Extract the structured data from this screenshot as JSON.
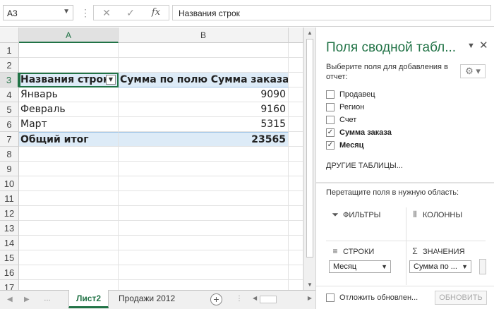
{
  "formula_bar": {
    "name_box": "A3",
    "cancel_icon": "✕",
    "enter_icon": "✓",
    "fx_label": "fx",
    "content": "Названия строк"
  },
  "sheet": {
    "columns": [
      "A",
      "B"
    ],
    "rows": [
      "1",
      "2",
      "3",
      "4",
      "5",
      "6",
      "7",
      "8",
      "9",
      "10",
      "11",
      "12",
      "13",
      "14",
      "15",
      "16",
      "17"
    ],
    "pivot": {
      "header_rows": "Названия строк",
      "header_values": "Сумма по полю Сумма заказа",
      "items": [
        {
          "label": "Январь",
          "value": "9090"
        },
        {
          "label": "Февраль",
          "value": "9160"
        },
        {
          "label": "Март",
          "value": "5315"
        }
      ],
      "total_label": "Общий итог",
      "total_value": "23565"
    }
  },
  "tabs": {
    "items": [
      "Лист2",
      "Продажи 2012"
    ],
    "active": "Лист2"
  },
  "pane": {
    "title": "Поля сводной табл...",
    "subtitle": "Выберите поля для добавления в отчет:",
    "fields": [
      {
        "label": "Продавец",
        "checked": false
      },
      {
        "label": "Регион",
        "checked": false
      },
      {
        "label": "Счет",
        "checked": false
      },
      {
        "label": "Сумма заказа",
        "checked": true
      },
      {
        "label": "Месяц",
        "checked": true
      }
    ],
    "other_tables": "ДРУГИЕ ТАБЛИЦЫ...",
    "drag_hint": "Перетащите поля в нужную область:",
    "areas": {
      "filters": "ФИЛЬТРЫ",
      "columns": "КОЛОННЫ",
      "rows": "СТРОКИ",
      "values": "ЗНАЧЕНИЯ"
    },
    "rows_chip": "Месяц",
    "values_chip": "Сумма по ...",
    "defer_label": "Отложить обновлен...",
    "update_button": "ОБНОВИТЬ"
  }
}
